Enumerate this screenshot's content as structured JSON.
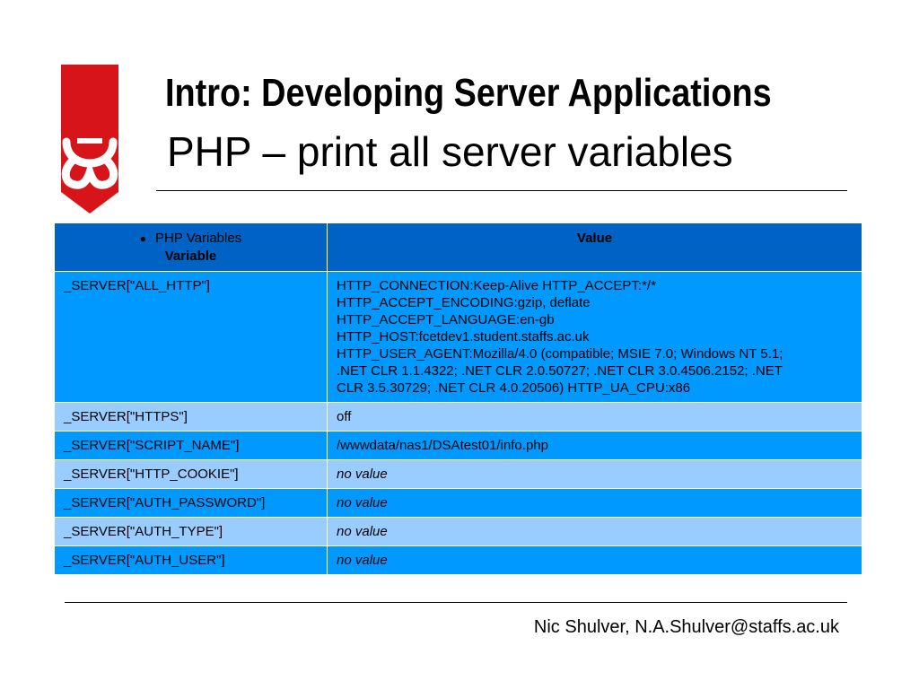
{
  "slide": {
    "title": "Intro: Developing Server Applications",
    "subtitle": "PHP – print all server variables",
    "footer": "Nic Shulver,  N.A.Shulver@staffs.ac.uk",
    "colors": {
      "logo_red": "#d7141a",
      "header_blue": "#0062c4",
      "row_dark": "#0099ff",
      "row_light": "#99ccff"
    }
  },
  "table": {
    "header": {
      "caption": "PHP Variables",
      "col1": "Variable",
      "col2": "Value"
    },
    "rows": [
      {
        "variable": "_SERVER[\"ALL_HTTP\"]",
        "value_lines": [
          "HTTP_CONNECTION:Keep-Alive HTTP_ACCEPT:*/*",
          "HTTP_ACCEPT_ENCODING:gzip, deflate",
          "HTTP_ACCEPT_LANGUAGE:en-gb",
          "HTTP_HOST:fcetdev1.student.staffs.ac.uk",
          "HTTP_USER_AGENT:Mozilla/4.0 (compatible; MSIE 7.0; Windows NT 5.1;",
          ".NET CLR 1.1.4322; .NET CLR 2.0.50727; .NET CLR 3.0.4506.2152; .NET",
          "CLR 3.5.30729; .NET CLR 4.0.20506) HTTP_UA_CPU:x86"
        ]
      },
      {
        "variable": "_SERVER[\"HTTPS\"]",
        "value": "off"
      },
      {
        "variable": "_SERVER[\"SCRIPT_NAME\"]",
        "value": "/wwwdata/nas1/DSAtest01/info.php"
      },
      {
        "variable": "_SERVER[\"HTTP_COOKIE\"]",
        "value": "no value"
      },
      {
        "variable": "_SERVER[\"AUTH_PASSWORD\"]",
        "value": "no value"
      },
      {
        "variable": "_SERVER[\"AUTH_TYPE\"]",
        "value": "no value"
      },
      {
        "variable": "_SERVER[\"AUTH_USER\"]",
        "value": "no value"
      }
    ]
  }
}
